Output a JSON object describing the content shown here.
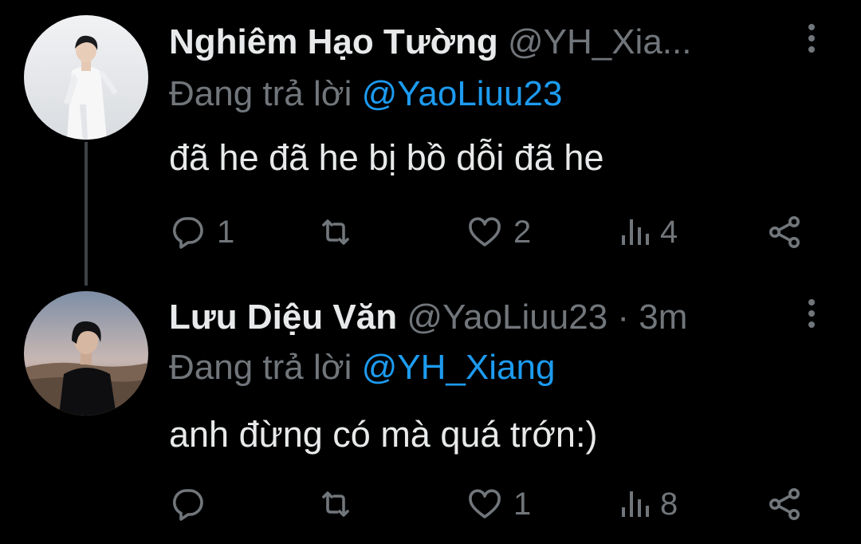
{
  "tweets": [
    {
      "display_name": "Nghiêm Hạo Tường",
      "handle": "@YH_Xia...",
      "separator": "",
      "time": "",
      "reply_prefix": "Đang trả lời",
      "reply_to": "@YaoLiuu23",
      "text": "đã he đã he bị bồ dỗi đã he",
      "counts": {
        "reply": "1",
        "retweet": "",
        "like": "2",
        "views": "4"
      },
      "avatar_icon": "avatar-photo-white-outfit"
    },
    {
      "display_name": "Lưu Diệu Văn",
      "handle": "@YaoLiuu23",
      "separator": " · ",
      "time": "3m",
      "reply_prefix": "Đang trả lời",
      "reply_to": "@YH_Xiang",
      "text": "anh đừng có mà quá trớn:)",
      "counts": {
        "reply": "",
        "retweet": "",
        "like": "1",
        "views": "8"
      },
      "avatar_icon": "avatar-photo-black-hoodie"
    }
  ],
  "icons": [
    "more-vertical-icon",
    "reply-icon",
    "retweet-icon",
    "like-icon",
    "views-icon",
    "share-icon"
  ],
  "colors": {
    "background": "#000000",
    "primary_text": "#e7e9ea",
    "secondary_text": "#71767b",
    "accent": "#1d9bf0",
    "thread_line": "#3e4144"
  }
}
